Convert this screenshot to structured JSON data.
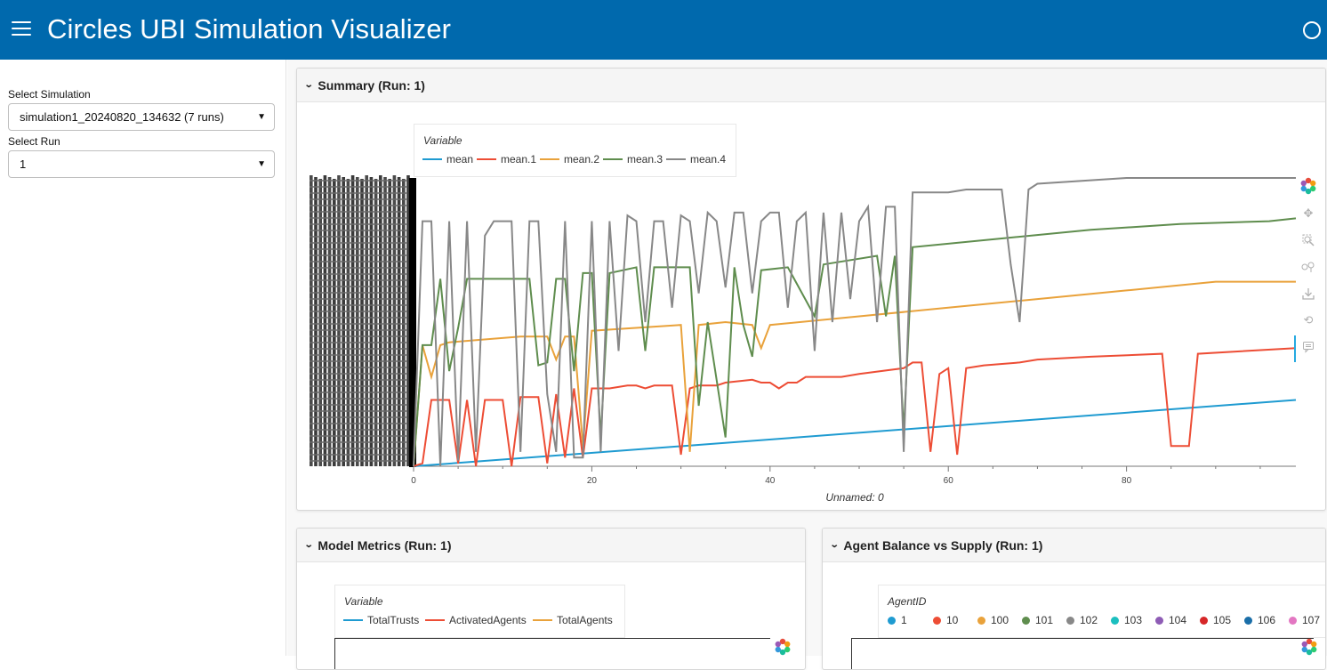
{
  "header": {
    "title": "Circles UBI Simulation Visualizer",
    "menu_icon": "hamburger-menu-icon",
    "status_icon": "busy-indicator-icon",
    "background": "#0069ad"
  },
  "sidebar": {
    "simulation": {
      "label": "Select Simulation",
      "value": "simulation1_20240820_134632 (7 runs)"
    },
    "run": {
      "label": "Select Run",
      "value": "1"
    }
  },
  "cards": {
    "summary": {
      "title": "Summary (Run: 1)"
    },
    "model_metrics": {
      "title": "Model Metrics (Run: 1)"
    },
    "agent_balance": {
      "title": "Agent Balance vs Supply (Run: 1)"
    }
  },
  "summary_legend": {
    "title": "Variable",
    "items": [
      {
        "label": "mean",
        "color": "#1f9bd1"
      },
      {
        "label": "mean.1",
        "color": "#ed4d35"
      },
      {
        "label": "mean.2",
        "color": "#e9a23b"
      },
      {
        "label": "mean.3",
        "color": "#5f8d4e"
      },
      {
        "label": "mean.4",
        "color": "#888888"
      }
    ]
  },
  "metrics_legend": {
    "title": "Variable",
    "items": [
      {
        "label": "TotalTrusts",
        "color": "#1f9bd1"
      },
      {
        "label": "ActivatedAgents",
        "color": "#ed4d35"
      },
      {
        "label": "TotalAgents",
        "color": "#e9a23b"
      }
    ]
  },
  "agent_legend": {
    "title": "AgentID",
    "items": [
      {
        "label": "1",
        "color": "#1f9bd1"
      },
      {
        "label": "10",
        "color": "#ed4d35"
      },
      {
        "label": "100",
        "color": "#e9a23b"
      },
      {
        "label": "101",
        "color": "#5f8d4e"
      },
      {
        "label": "102",
        "color": "#888888"
      },
      {
        "label": "103",
        "color": "#1cbfbf"
      },
      {
        "label": "104",
        "color": "#8e5cb5"
      },
      {
        "label": "105",
        "color": "#d62728"
      },
      {
        "label": "106",
        "color": "#1a6ea8"
      },
      {
        "label": "107",
        "color": "#e377c2"
      }
    ]
  },
  "toolbar": {
    "tools": [
      "bokeh-logo-icon",
      "pan-icon",
      "box-zoom-icon",
      "wheel-zoom-icon",
      "save-icon",
      "reset-icon",
      "hover-icon"
    ]
  },
  "chart_data": {
    "type": "line",
    "xlabel": "Unnamed: 0",
    "ylabel": "",
    "xlim": [
      0,
      99
    ],
    "ylim": [
      0,
      100
    ],
    "xticks": [
      "0",
      "20",
      "40",
      "60",
      "80"
    ],
    "y_tick_labels_note": "overlapping illegible y tick labels",
    "legend_title": "Variable",
    "legend_position": "top-left",
    "series": [
      {
        "name": "mean",
        "color": "#1f9bd1",
        "points": [
          [
            0,
            0
          ],
          [
            99,
            23
          ]
        ]
      },
      {
        "name": "mean.1",
        "color": "#ed4d35",
        "points": [
          [
            0,
            0
          ],
          [
            1,
            1
          ],
          [
            2,
            23
          ],
          [
            4,
            23
          ],
          [
            5,
            1
          ],
          [
            6,
            23
          ],
          [
            7,
            0
          ],
          [
            8,
            23
          ],
          [
            10,
            23
          ],
          [
            11,
            0
          ],
          [
            12,
            24
          ],
          [
            14,
            24
          ],
          [
            15,
            1
          ],
          [
            16,
            25
          ],
          [
            17,
            3
          ],
          [
            18,
            27
          ],
          [
            19,
            3
          ],
          [
            20,
            27
          ],
          [
            22,
            27
          ],
          [
            24,
            28
          ],
          [
            25,
            28
          ],
          [
            26,
            27
          ],
          [
            27,
            28
          ],
          [
            28,
            28
          ],
          [
            29,
            28
          ],
          [
            30,
            4
          ],
          [
            31,
            27
          ],
          [
            32,
            28
          ],
          [
            34,
            28
          ],
          [
            35,
            29
          ],
          [
            38,
            30
          ],
          [
            39,
            29
          ],
          [
            40,
            29
          ],
          [
            41,
            27
          ],
          [
            42,
            29
          ],
          [
            43,
            29
          ],
          [
            44,
            31
          ],
          [
            46,
            31
          ],
          [
            48,
            31
          ],
          [
            50,
            32
          ],
          [
            55,
            34
          ],
          [
            56,
            36
          ],
          [
            57,
            36
          ],
          [
            58,
            5
          ],
          [
            59,
            32
          ],
          [
            60,
            34
          ],
          [
            61,
            4
          ],
          [
            62,
            34
          ],
          [
            64,
            35
          ],
          [
            68,
            36
          ],
          [
            70,
            37
          ],
          [
            76,
            38
          ],
          [
            84,
            39
          ],
          [
            85,
            7
          ],
          [
            87,
            7
          ],
          [
            88,
            39
          ],
          [
            99,
            41
          ]
        ]
      },
      {
        "name": "mean.2",
        "color": "#e9a23b",
        "points": [
          [
            0,
            0
          ],
          [
            1,
            42
          ],
          [
            2,
            31
          ],
          [
            3,
            42
          ],
          [
            4,
            43
          ],
          [
            12,
            45
          ],
          [
            15,
            45
          ],
          [
            16,
            37
          ],
          [
            17,
            45
          ],
          [
            18,
            45
          ],
          [
            19,
            7
          ],
          [
            20,
            47
          ],
          [
            30,
            49
          ],
          [
            31,
            5
          ],
          [
            32,
            49
          ],
          [
            35,
            50
          ],
          [
            38,
            49
          ],
          [
            39,
            41
          ],
          [
            40,
            49
          ],
          [
            50,
            52
          ],
          [
            60,
            55
          ],
          [
            70,
            58
          ],
          [
            80,
            61
          ],
          [
            90,
            64
          ],
          [
            99,
            64
          ]
        ]
      },
      {
        "name": "mean.3",
        "color": "#5f8d4e",
        "points": [
          [
            0,
            0
          ],
          [
            1,
            42
          ],
          [
            2,
            42
          ],
          [
            3,
            65
          ],
          [
            4,
            33
          ],
          [
            5,
            48
          ],
          [
            6,
            65
          ],
          [
            7,
            65
          ],
          [
            8,
            65
          ],
          [
            13,
            65
          ],
          [
            14,
            35
          ],
          [
            15,
            36
          ],
          [
            16,
            65
          ],
          [
            17,
            65
          ],
          [
            18,
            33
          ],
          [
            19,
            67
          ],
          [
            20,
            67
          ],
          [
            21,
            10
          ],
          [
            22,
            67
          ],
          [
            25,
            69
          ],
          [
            26,
            40
          ],
          [
            27,
            69
          ],
          [
            31,
            69
          ],
          [
            32,
            21
          ],
          [
            33,
            50
          ],
          [
            35,
            10
          ],
          [
            36,
            69
          ],
          [
            37,
            49
          ],
          [
            38,
            38
          ],
          [
            39,
            68
          ],
          [
            42,
            69
          ],
          [
            45,
            52
          ],
          [
            46,
            70
          ],
          [
            52,
            73
          ],
          [
            53,
            52
          ],
          [
            54,
            73
          ],
          [
            55,
            12
          ],
          [
            56,
            76
          ],
          [
            66,
            79
          ],
          [
            76,
            82
          ],
          [
            86,
            84
          ],
          [
            96,
            85
          ],
          [
            99,
            86
          ]
        ]
      },
      {
        "name": "mean.4",
        "color": "#888888",
        "points": [
          [
            0,
            0
          ],
          [
            1,
            85
          ],
          [
            2,
            85
          ],
          [
            3,
            0
          ],
          [
            4,
            85
          ],
          [
            5,
            2
          ],
          [
            6,
            85
          ],
          [
            7,
            5
          ],
          [
            8,
            80
          ],
          [
            9,
            85
          ],
          [
            10,
            85
          ],
          [
            11,
            85
          ],
          [
            12,
            5
          ],
          [
            13,
            85
          ],
          [
            14,
            85
          ],
          [
            15,
            25
          ],
          [
            16,
            5
          ],
          [
            17,
            85
          ],
          [
            18,
            3
          ],
          [
            19,
            3
          ],
          [
            20,
            85
          ],
          [
            21,
            5
          ],
          [
            22,
            85
          ],
          [
            23,
            40
          ],
          [
            24,
            87
          ],
          [
            25,
            85
          ],
          [
            26,
            50
          ],
          [
            27,
            85
          ],
          [
            28,
            85
          ],
          [
            29,
            55
          ],
          [
            30,
            87
          ],
          [
            31,
            85
          ],
          [
            32,
            60
          ],
          [
            33,
            88
          ],
          [
            34,
            85
          ],
          [
            35,
            62
          ],
          [
            36,
            88
          ],
          [
            37,
            88
          ],
          [
            38,
            60
          ],
          [
            39,
            85
          ],
          [
            40,
            88
          ],
          [
            41,
            88
          ],
          [
            42,
            55
          ],
          [
            43,
            85
          ],
          [
            44,
            88
          ],
          [
            45,
            40
          ],
          [
            46,
            88
          ],
          [
            47,
            50
          ],
          [
            48,
            88
          ],
          [
            49,
            58
          ],
          [
            50,
            85
          ],
          [
            51,
            90
          ],
          [
            52,
            50
          ],
          [
            53,
            90
          ],
          [
            54,
            90
          ],
          [
            55,
            5
          ],
          [
            56,
            95
          ],
          [
            58,
            95
          ],
          [
            60,
            95
          ],
          [
            62,
            96
          ],
          [
            64,
            96
          ],
          [
            66,
            96
          ],
          [
            67,
            70
          ],
          [
            68,
            50
          ],
          [
            69,
            96
          ],
          [
            70,
            98
          ],
          [
            80,
            100
          ],
          [
            90,
            100
          ],
          [
            99,
            100
          ]
        ]
      }
    ]
  }
}
